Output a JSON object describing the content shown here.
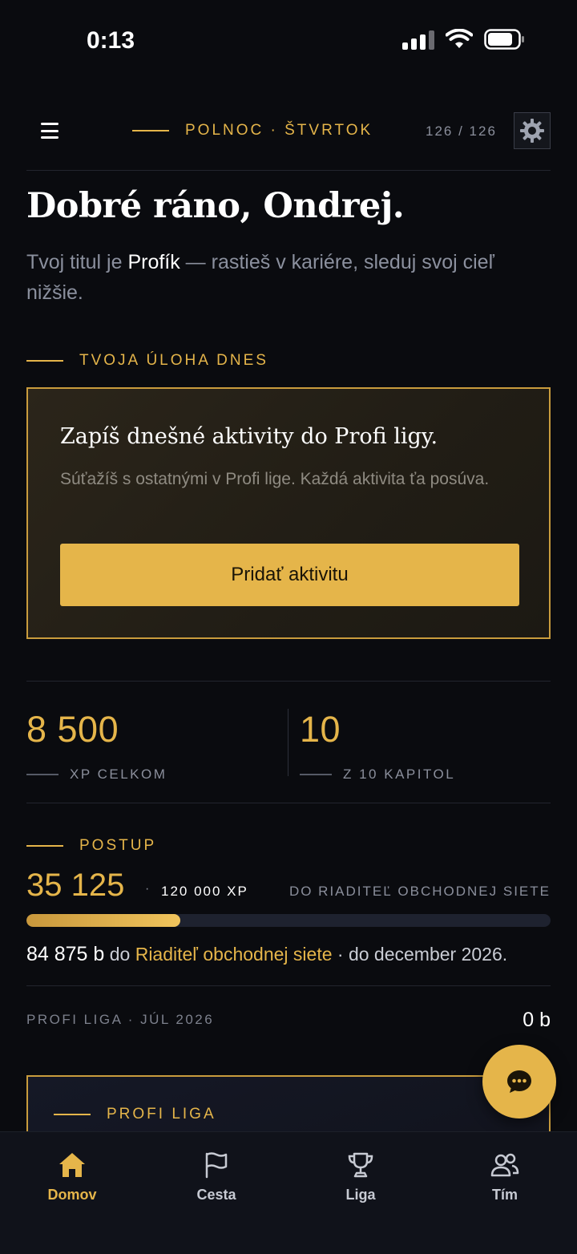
{
  "status": {
    "time": "0:13"
  },
  "header": {
    "label": "POLNOC · ŠTVRTOK",
    "counter": "126 / 126"
  },
  "greeting": {
    "title": "Dobré ráno, Ondrej.",
    "subtitle_pre": "Tvoj titul je ",
    "subtitle_title": "Profík",
    "subtitle_post": " — rastieš v kariére, sleduj svoj cieľ nižšie."
  },
  "task": {
    "section_label": "TVOJA ÚLOHA DNES",
    "title": "Zapíš dnešné aktivity do Profi ligy.",
    "description": "Súťažíš s ostatnými v Profi lige. Každá aktivita ťa posúva.",
    "button": "Pridať aktivitu"
  },
  "stats": [
    {
      "value": "8 500",
      "label": "XP CELKOM"
    },
    {
      "value": "10",
      "label": "Z 10 KAPITOL"
    }
  ],
  "progress": {
    "section_label": "POSTUP",
    "value": "35 125",
    "separator": "·",
    "target": "120 000 XP",
    "goal": "DO RIADITEĽ OBCHODNEJ SIETE",
    "percent": 29.3,
    "remaining": "84 875 b",
    "text_do": " do ",
    "goal_name": "Riaditeľ obchodnej siete",
    "deadline": " · do december 2026."
  },
  "liga": {
    "label": "PROFI LIGA · JÚL 2026",
    "points": "0 b",
    "card_label": "PROFI LIGA"
  },
  "nav": [
    {
      "label": "Domov",
      "icon": "home-icon",
      "active": true
    },
    {
      "label": "Cesta",
      "icon": "flag-icon",
      "active": false
    },
    {
      "label": "Liga",
      "icon": "trophy-icon",
      "active": false
    },
    {
      "label": "Tím",
      "icon": "users-icon",
      "active": false
    }
  ],
  "colors": {
    "accent": "#e5b54a",
    "background": "#0a0b0f"
  }
}
